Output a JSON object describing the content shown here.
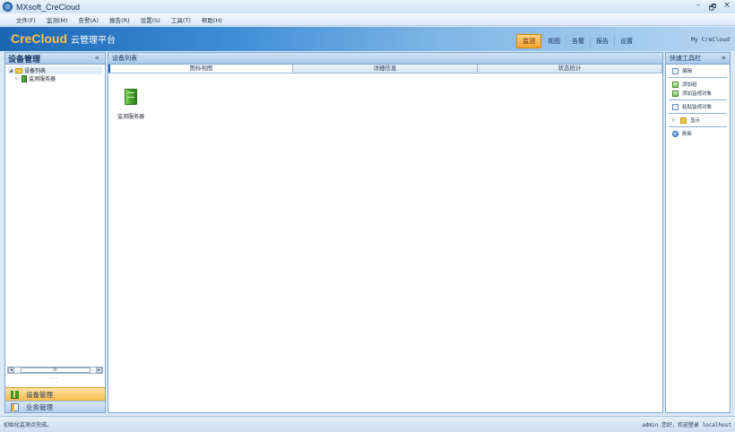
{
  "window": {
    "title": "MXsoft_CreCloud",
    "icon": "app-logo-icon",
    "controls": [
      "–",
      "🗗",
      "×"
    ]
  },
  "menu": [
    "文件(F)",
    "监测(M)",
    "告警(A)",
    "报告(R)",
    "设置(S)",
    "工具(T)",
    "帮助(H)"
  ],
  "banner": {
    "brand": "CreCloud",
    "subtitle": "云管理平台",
    "my_link": "My CreCloud"
  },
  "top_nav": [
    "监测",
    "视图",
    "告警",
    "报告",
    "设置"
  ],
  "left_panel": {
    "title": "设备管理",
    "collapse": "«",
    "tree": [
      {
        "label": "设备列表",
        "expanded": true
      },
      {
        "label": "监测服务器",
        "expanded": false
      }
    ],
    "scroll_label": "III",
    "grip": "⋯⋯",
    "bottom_nav": [
      "设备管理",
      "业务管理"
    ]
  },
  "center_panel": {
    "title": "设备列表",
    "tabs": [
      "图标视图",
      "详细信息",
      "状态统计"
    ],
    "devices": [
      {
        "label": "监测服务器",
        "icon": "server-icon"
      }
    ]
  },
  "right_panel": {
    "title": "快速工具栏",
    "expand": "»",
    "groups": [
      [
        "编辑"
      ],
      [
        "添加组",
        "添加监视对象"
      ],
      [
        "粘贴监视对象"
      ],
      [
        "显示"
      ],
      [
        "刷新"
      ]
    ]
  },
  "status": {
    "left": "初始化监测点完成。",
    "right": "admin 您好，欢迎登录 localhost"
  },
  "colors": {
    "accent": "#f0a231",
    "panel_border": "#7fa6d1",
    "brand": "#f7c34a"
  }
}
